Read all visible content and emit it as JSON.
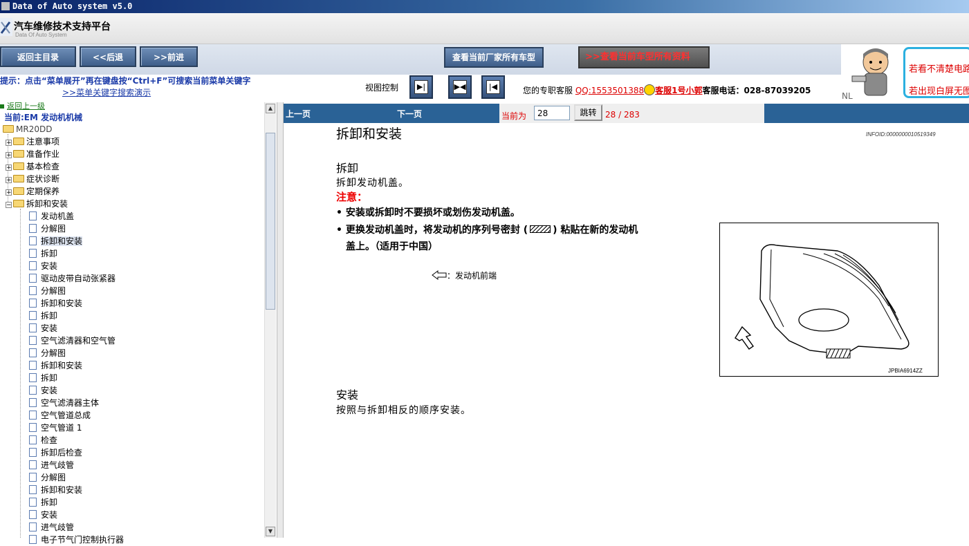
{
  "window": {
    "title": "Data of Auto system v5.0"
  },
  "header": {
    "app_name": "汽车维修技术支持平台",
    "app_sub": "Data Of Auto System"
  },
  "toolbar": {
    "home": "返回主目录",
    "back": "<<后退",
    "forward": ">>前进",
    "all_models": "查看当前厂家所有车型",
    "all_data": "查看当前车型所有资料",
    "tip": "提示：点击“菜单展开”再在键盘按“Ctrl+F”可搜索当前菜单关键字",
    "demo_link": ">>菜单关键字搜索演示",
    "view_label": "视图控制",
    "service_prefix": "您的专职客服",
    "qq": "QQ:1553501388",
    "agent": "客服1号小郭",
    "phone": "客服电话：028-87039205"
  },
  "promo": {
    "line1": "若看不清楚电路",
    "line2": "若出现白屏无图",
    "nl": "NL"
  },
  "sidebar": {
    "back_level": "返回上一级",
    "current": "当前:EM 发动机机械",
    "root": "MR20DD",
    "folders": [
      "注意事项",
      "准备作业",
      "基本检查",
      "症状诊断",
      "定期保养",
      "拆卸和安装"
    ],
    "leaves": [
      "发动机盖",
      "分解图",
      "拆卸和安装",
      "拆卸",
      "安装",
      "驱动皮带自动张紧器",
      "分解图",
      "拆卸和安装",
      "拆卸",
      "安装",
      "空气滤清器和空气管",
      "分解图",
      "拆卸和安装",
      "拆卸",
      "安装",
      "空气滤清器主体",
      "空气管道总成",
      "空气管道 1",
      "检查",
      "拆卸后检查",
      "进气歧管",
      "分解图",
      "拆卸和安装",
      "拆卸",
      "安装",
      "进气歧管",
      "电子节气门控制执行器"
    ],
    "selected_index": 2
  },
  "pager": {
    "prev": "上一页",
    "next": "下一页",
    "current_label": "当前为",
    "page_value": "28",
    "jump": "跳转",
    "count": "28 / 283"
  },
  "document": {
    "title": "拆卸和安装",
    "infoid": "INFOID:0000000010519349",
    "remove_heading": "拆卸",
    "remove_text": "拆卸发动机盖。",
    "caution": "注意：",
    "bullet1": "安装或拆卸时不要损坏或划伤发动机盖。",
    "bullet2_a": "更换发动机盖时，将发动机的序列号密封",
    "bullet2_b": "粘贴在新的发动机",
    "bullet2_c": "盖上。（适用于中国）",
    "front_note": "：发动机前端",
    "figure_code": "JPBIA6914ZZ",
    "install_heading": "安装",
    "install_text": "按照与拆卸相反的顺序安装。"
  },
  "colors": {
    "title_bar": "#0a246a",
    "content_bar": "#2a6296",
    "accent_red": "#dd0000",
    "link_blue": "#1a3aa8"
  }
}
